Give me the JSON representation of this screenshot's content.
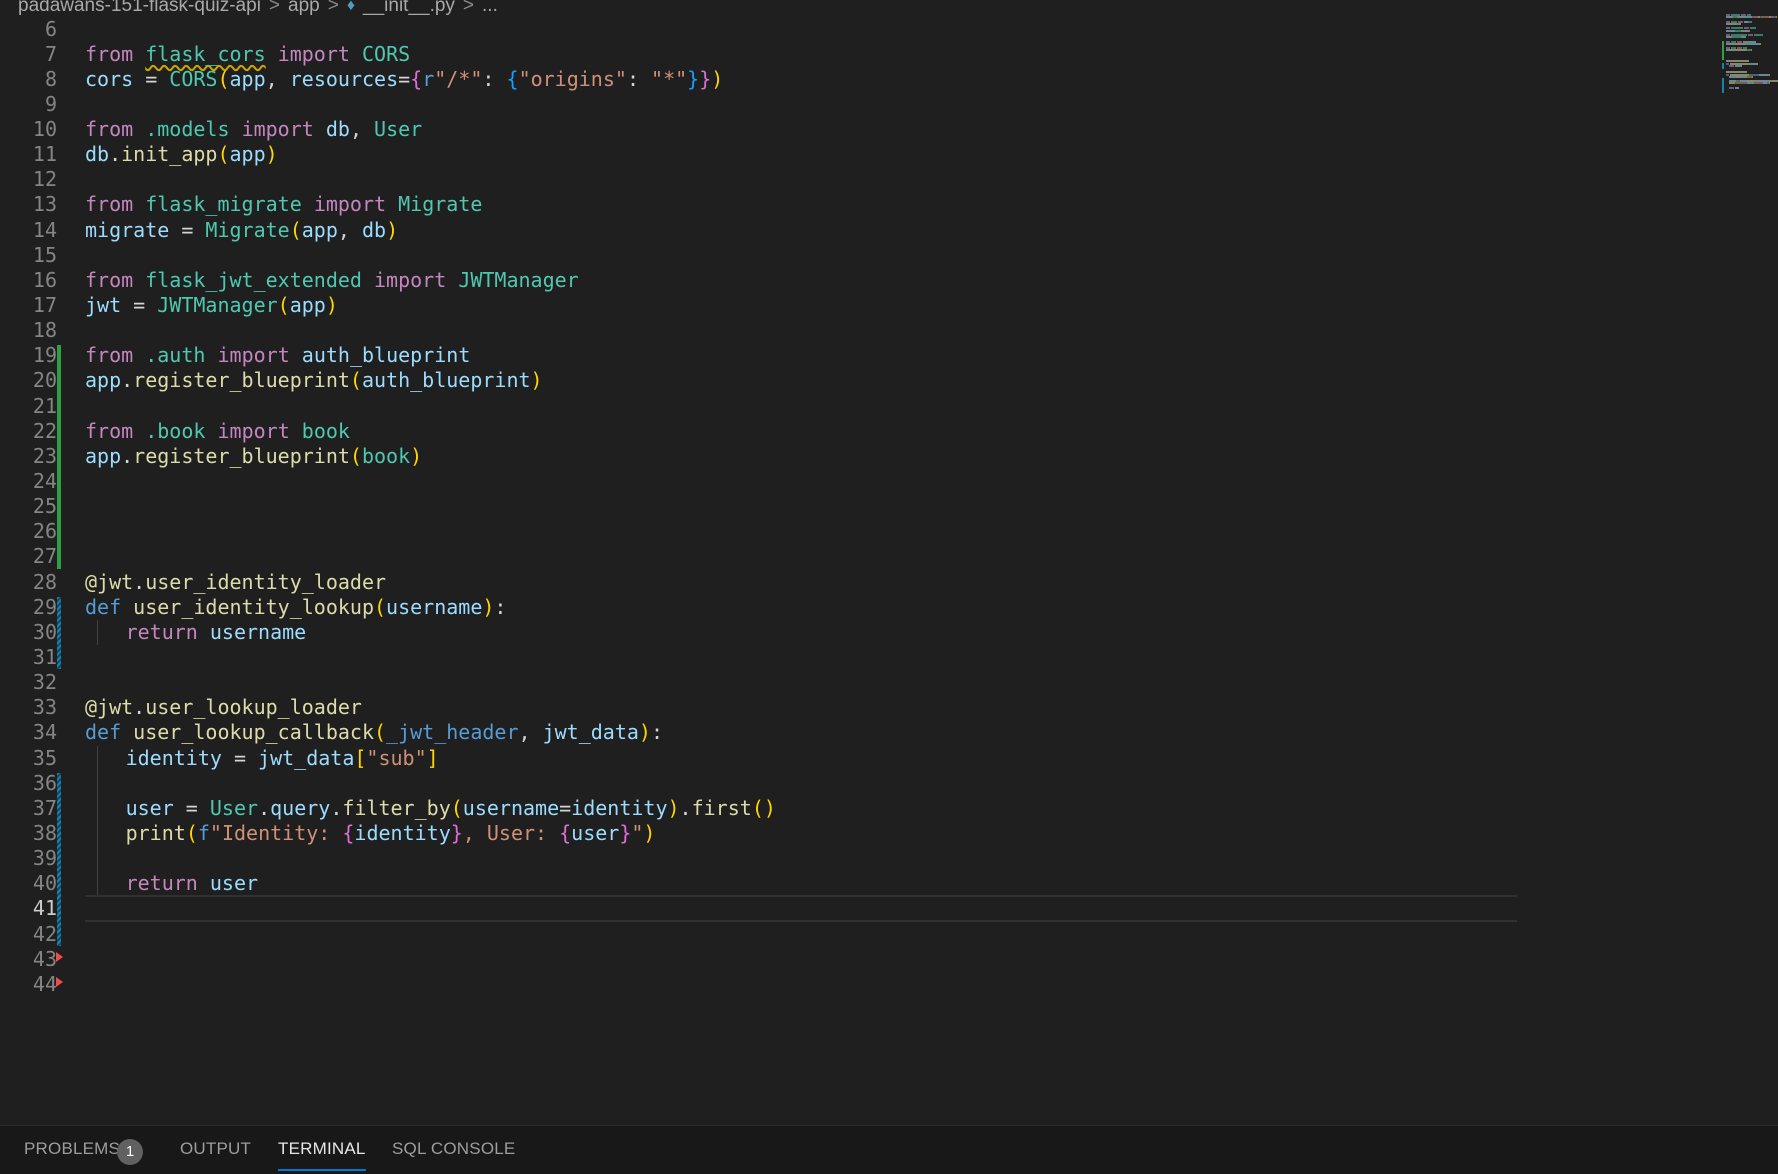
{
  "breadcrumb": {
    "items": [
      "padawans-151-flask-quiz-api",
      "app",
      "__init__.py",
      "..."
    ],
    "separator": ">",
    "file_icon": "python-file-icon"
  },
  "editor": {
    "language": "python",
    "current_line": 41,
    "lines": [
      {
        "n": 6,
        "tokens": []
      },
      {
        "n": 7,
        "tokens": [
          {
            "t": "from",
            "c": "kw"
          },
          {
            "t": " ",
            "c": "op"
          },
          {
            "t": "flask_cors",
            "c": "cls",
            "squiggle": true
          },
          {
            "t": " ",
            "c": "op"
          },
          {
            "t": "import",
            "c": "kw"
          },
          {
            "t": " ",
            "c": "op"
          },
          {
            "t": "CORS",
            "c": "cls"
          }
        ]
      },
      {
        "n": 8,
        "tokens": [
          {
            "t": "cors",
            "c": "var"
          },
          {
            "t": " = ",
            "c": "op"
          },
          {
            "t": "CORS",
            "c": "cls"
          },
          {
            "t": "(",
            "c": "br1"
          },
          {
            "t": "app",
            "c": "var"
          },
          {
            "t": ", ",
            "c": "op"
          },
          {
            "t": "resources",
            "c": "var"
          },
          {
            "t": "=",
            "c": "op"
          },
          {
            "t": "{",
            "c": "br2"
          },
          {
            "t": "r",
            "c": "def"
          },
          {
            "t": "\"/*\"",
            "c": "str"
          },
          {
            "t": ": ",
            "c": "op"
          },
          {
            "t": "{",
            "c": "br3"
          },
          {
            "t": "\"origins\"",
            "c": "str"
          },
          {
            "t": ": ",
            "c": "op"
          },
          {
            "t": "\"*\"",
            "c": "str"
          },
          {
            "t": "}",
            "c": "br3"
          },
          {
            "t": "}",
            "c": "br2"
          },
          {
            "t": ")",
            "c": "br1"
          }
        ]
      },
      {
        "n": 9,
        "tokens": []
      },
      {
        "n": 10,
        "tokens": [
          {
            "t": "from",
            "c": "kw"
          },
          {
            "t": " ",
            "c": "op"
          },
          {
            "t": ".models",
            "c": "cls"
          },
          {
            "t": " ",
            "c": "op"
          },
          {
            "t": "import",
            "c": "kw"
          },
          {
            "t": " ",
            "c": "op"
          },
          {
            "t": "db",
            "c": "var"
          },
          {
            "t": ", ",
            "c": "op"
          },
          {
            "t": "User",
            "c": "cls"
          }
        ]
      },
      {
        "n": 11,
        "tokens": [
          {
            "t": "db",
            "c": "var"
          },
          {
            "t": ".",
            "c": "op"
          },
          {
            "t": "init_app",
            "c": "fn"
          },
          {
            "t": "(",
            "c": "br1"
          },
          {
            "t": "app",
            "c": "var"
          },
          {
            "t": ")",
            "c": "br1"
          }
        ]
      },
      {
        "n": 12,
        "tokens": []
      },
      {
        "n": 13,
        "tokens": [
          {
            "t": "from",
            "c": "kw"
          },
          {
            "t": " ",
            "c": "op"
          },
          {
            "t": "flask_migrate",
            "c": "cls"
          },
          {
            "t": " ",
            "c": "op"
          },
          {
            "t": "import",
            "c": "kw"
          },
          {
            "t": " ",
            "c": "op"
          },
          {
            "t": "Migrate",
            "c": "cls"
          }
        ]
      },
      {
        "n": 14,
        "tokens": [
          {
            "t": "migrate",
            "c": "var"
          },
          {
            "t": " = ",
            "c": "op"
          },
          {
            "t": "Migrate",
            "c": "cls"
          },
          {
            "t": "(",
            "c": "br1"
          },
          {
            "t": "app",
            "c": "var"
          },
          {
            "t": ", ",
            "c": "op"
          },
          {
            "t": "db",
            "c": "var"
          },
          {
            "t": ")",
            "c": "br1"
          }
        ]
      },
      {
        "n": 15,
        "tokens": []
      },
      {
        "n": 16,
        "tokens": [
          {
            "t": "from",
            "c": "kw"
          },
          {
            "t": " ",
            "c": "op"
          },
          {
            "t": "flask_jwt_extended",
            "c": "cls"
          },
          {
            "t": " ",
            "c": "op"
          },
          {
            "t": "import",
            "c": "kw"
          },
          {
            "t": " ",
            "c": "op"
          },
          {
            "t": "JWTManager",
            "c": "cls"
          }
        ]
      },
      {
        "n": 17,
        "tokens": [
          {
            "t": "jwt",
            "c": "var"
          },
          {
            "t": " = ",
            "c": "op"
          },
          {
            "t": "JWTManager",
            "c": "cls"
          },
          {
            "t": "(",
            "c": "br1"
          },
          {
            "t": "app",
            "c": "var"
          },
          {
            "t": ")",
            "c": "br1"
          }
        ]
      },
      {
        "n": 18,
        "tokens": []
      },
      {
        "n": 19,
        "tokens": [
          {
            "t": "from",
            "c": "kw"
          },
          {
            "t": " ",
            "c": "op"
          },
          {
            "t": ".auth",
            "c": "cls"
          },
          {
            "t": " ",
            "c": "op"
          },
          {
            "t": "import",
            "c": "kw"
          },
          {
            "t": " ",
            "c": "op"
          },
          {
            "t": "auth_blueprint",
            "c": "var"
          }
        ]
      },
      {
        "n": 20,
        "tokens": [
          {
            "t": "app",
            "c": "var"
          },
          {
            "t": ".",
            "c": "op"
          },
          {
            "t": "register_blueprint",
            "c": "fn"
          },
          {
            "t": "(",
            "c": "br1"
          },
          {
            "t": "auth_blueprint",
            "c": "var"
          },
          {
            "t": ")",
            "c": "br1"
          }
        ]
      },
      {
        "n": 21,
        "tokens": []
      },
      {
        "n": 22,
        "tokens": [
          {
            "t": "from",
            "c": "kw"
          },
          {
            "t": " ",
            "c": "op"
          },
          {
            "t": ".book",
            "c": "cls"
          },
          {
            "t": " ",
            "c": "op"
          },
          {
            "t": "import",
            "c": "kw"
          },
          {
            "t": " ",
            "c": "op"
          },
          {
            "t": "book",
            "c": "cls"
          }
        ]
      },
      {
        "n": 23,
        "tokens": [
          {
            "t": "app",
            "c": "var"
          },
          {
            "t": ".",
            "c": "op"
          },
          {
            "t": "register_blueprint",
            "c": "fn"
          },
          {
            "t": "(",
            "c": "br1"
          },
          {
            "t": "book",
            "c": "cls"
          },
          {
            "t": ")",
            "c": "br1"
          }
        ]
      },
      {
        "n": 24,
        "tokens": []
      },
      {
        "n": 25,
        "tokens": []
      },
      {
        "n": 26,
        "tokens": []
      },
      {
        "n": 27,
        "tokens": []
      },
      {
        "n": 28,
        "tokens": [
          {
            "t": "@jwt",
            "c": "fn"
          },
          {
            "t": ".",
            "c": "op"
          },
          {
            "t": "user_identity_loader",
            "c": "fn"
          }
        ]
      },
      {
        "n": 29,
        "tokens": [
          {
            "t": "def",
            "c": "def"
          },
          {
            "t": " ",
            "c": "op"
          },
          {
            "t": "user_identity_lookup",
            "c": "fn"
          },
          {
            "t": "(",
            "c": "br1"
          },
          {
            "t": "username",
            "c": "var"
          },
          {
            "t": ")",
            "c": "br1"
          },
          {
            "t": ":",
            "c": "op"
          }
        ]
      },
      {
        "n": 30,
        "indent": 1,
        "tokens": [
          {
            "t": "return",
            "c": "kw"
          },
          {
            "t": " ",
            "c": "op"
          },
          {
            "t": "username",
            "c": "var"
          }
        ]
      },
      {
        "n": 31,
        "tokens": []
      },
      {
        "n": 32,
        "tokens": []
      },
      {
        "n": 33,
        "tokens": [
          {
            "t": "@jwt",
            "c": "fn"
          },
          {
            "t": ".",
            "c": "op"
          },
          {
            "t": "user_lookup_loader",
            "c": "fn"
          }
        ]
      },
      {
        "n": 34,
        "tokens": [
          {
            "t": "def",
            "c": "def"
          },
          {
            "t": " ",
            "c": "op"
          },
          {
            "t": "user_lookup_callback",
            "c": "fn"
          },
          {
            "t": "(",
            "c": "br1"
          },
          {
            "t": "_jwt_header",
            "c": "def"
          },
          {
            "t": ", ",
            "c": "op"
          },
          {
            "t": "jwt_data",
            "c": "var"
          },
          {
            "t": ")",
            "c": "br1"
          },
          {
            "t": ":",
            "c": "op"
          }
        ]
      },
      {
        "n": 35,
        "indent": 1,
        "tokens": [
          {
            "t": "identity",
            "c": "var"
          },
          {
            "t": " = ",
            "c": "op"
          },
          {
            "t": "jwt_data",
            "c": "var"
          },
          {
            "t": "[",
            "c": "br1"
          },
          {
            "t": "\"sub\"",
            "c": "str"
          },
          {
            "t": "]",
            "c": "br1"
          }
        ]
      },
      {
        "n": 36,
        "indent": 1,
        "tokens": []
      },
      {
        "n": 37,
        "indent": 1,
        "tokens": [
          {
            "t": "user",
            "c": "var"
          },
          {
            "t": " = ",
            "c": "op"
          },
          {
            "t": "User",
            "c": "cls"
          },
          {
            "t": ".",
            "c": "op"
          },
          {
            "t": "query",
            "c": "var"
          },
          {
            "t": ".",
            "c": "op"
          },
          {
            "t": "filter_by",
            "c": "fn"
          },
          {
            "t": "(",
            "c": "br1"
          },
          {
            "t": "username",
            "c": "var"
          },
          {
            "t": "=",
            "c": "op"
          },
          {
            "t": "identity",
            "c": "var"
          },
          {
            "t": ")",
            "c": "br1"
          },
          {
            "t": ".",
            "c": "op"
          },
          {
            "t": "first",
            "c": "fn"
          },
          {
            "t": "()",
            "c": "br1"
          }
        ]
      },
      {
        "n": 38,
        "indent": 1,
        "tokens": [
          {
            "t": "print",
            "c": "fn"
          },
          {
            "t": "(",
            "c": "br1"
          },
          {
            "t": "f",
            "c": "def"
          },
          {
            "t": "\"Identity: ",
            "c": "str"
          },
          {
            "t": "{",
            "c": "br2"
          },
          {
            "t": "identity",
            "c": "var"
          },
          {
            "t": "}",
            "c": "br2"
          },
          {
            "t": ", User: ",
            "c": "str"
          },
          {
            "t": "{",
            "c": "br2"
          },
          {
            "t": "user",
            "c": "var"
          },
          {
            "t": "}",
            "c": "br2"
          },
          {
            "t": "\"",
            "c": "str"
          },
          {
            "t": ")",
            "c": "br1"
          }
        ]
      },
      {
        "n": 39,
        "indent": 1,
        "tokens": []
      },
      {
        "n": 40,
        "indent": 1,
        "tokens": [
          {
            "t": "return",
            "c": "kw"
          },
          {
            "t": " ",
            "c": "op"
          },
          {
            "t": "user",
            "c": "var"
          }
        ]
      },
      {
        "n": 41,
        "tokens": []
      },
      {
        "n": 42,
        "tokens": []
      },
      {
        "n": 43,
        "tokens": []
      },
      {
        "n": 44,
        "tokens": []
      }
    ],
    "git_markers": {
      "added": [
        [
          19,
          27
        ]
      ],
      "modified": [
        [
          29,
          31
        ],
        [
          36,
          42
        ]
      ],
      "deleted": [
        43.4,
        44.4
      ]
    }
  },
  "panel": {
    "tabs": [
      {
        "label": "PROBLEMS",
        "badge": "1",
        "active": false
      },
      {
        "label": "OUTPUT",
        "active": false
      },
      {
        "label": "TERMINAL",
        "active": true
      },
      {
        "label": "SQL CONSOLE",
        "active": false
      }
    ]
  },
  "colors": {
    "background": "#1f1f1f",
    "keyword": "#c586c0",
    "class": "#4ec9b0",
    "variable": "#9cdcfe",
    "function": "#dcdcaa",
    "string": "#ce9178",
    "git_added": "#2ea043",
    "git_modified": "#1b81a8",
    "accent": "#0078d4"
  }
}
